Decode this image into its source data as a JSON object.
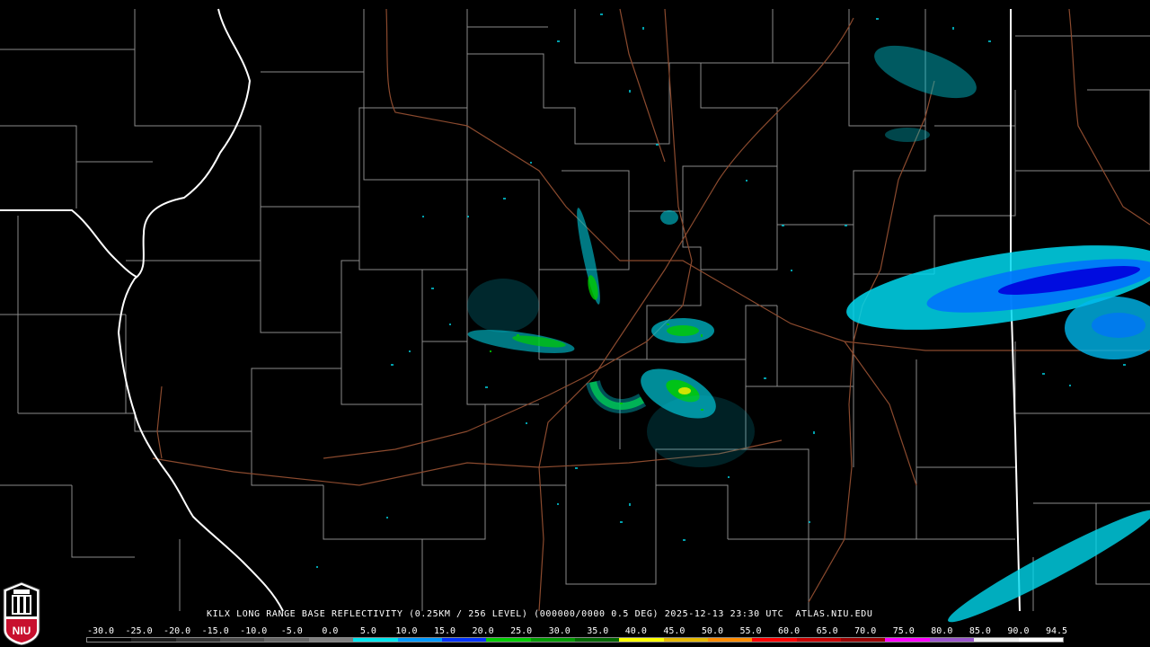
{
  "header": {
    "title": "KILX LONG RANGE BASE REFLECTIVITY (0.25KM / 256 LEVEL) (000000/0000 0.5 DEG) 2025-12-13 23:30 UTC  ATLAS.NIU.EDU"
  },
  "logo": {
    "text": "NIU",
    "colors": {
      "red": "#c8102e",
      "white": "#ffffff",
      "black": "#000000"
    }
  },
  "scale": {
    "labels": [
      "-30.0",
      "-25.0",
      "-20.0",
      "-15.0",
      "-10.0",
      "-5.0",
      "0.0",
      "5.0",
      "10.0",
      "15.0",
      "20.0",
      "25.0",
      "30.0",
      "35.0",
      "40.0",
      "45.0",
      "50.0",
      "55.0",
      "60.0",
      "65.0",
      "70.0",
      "75.0",
      "80.0",
      "85.0",
      "90.0",
      "94.5"
    ],
    "colors": [
      "#000000",
      "#1a1a1a",
      "#333333",
      "#4d4d4d",
      "#666666",
      "#808080",
      "#00e5ee",
      "#0099ff",
      "#0033ff",
      "#00cc00",
      "#009900",
      "#006600",
      "#ffff00",
      "#e5b800",
      "#ff8c00",
      "#ff0000",
      "#c80000",
      "#990000",
      "#ff00ff",
      "#9955cc",
      "#eeeeee",
      "#ffffff"
    ]
  },
  "map": {
    "colors": {
      "state_border": "#ffffff",
      "county_border": "#8a8a8a",
      "highway": "#8b4a2e",
      "light_echo": "#00d8ee",
      "moderate_echo": "#0070ff",
      "strong_echo": "#0000dd",
      "green_echo": "#00e000",
      "yellow_echo": "#e8e800"
    }
  }
}
